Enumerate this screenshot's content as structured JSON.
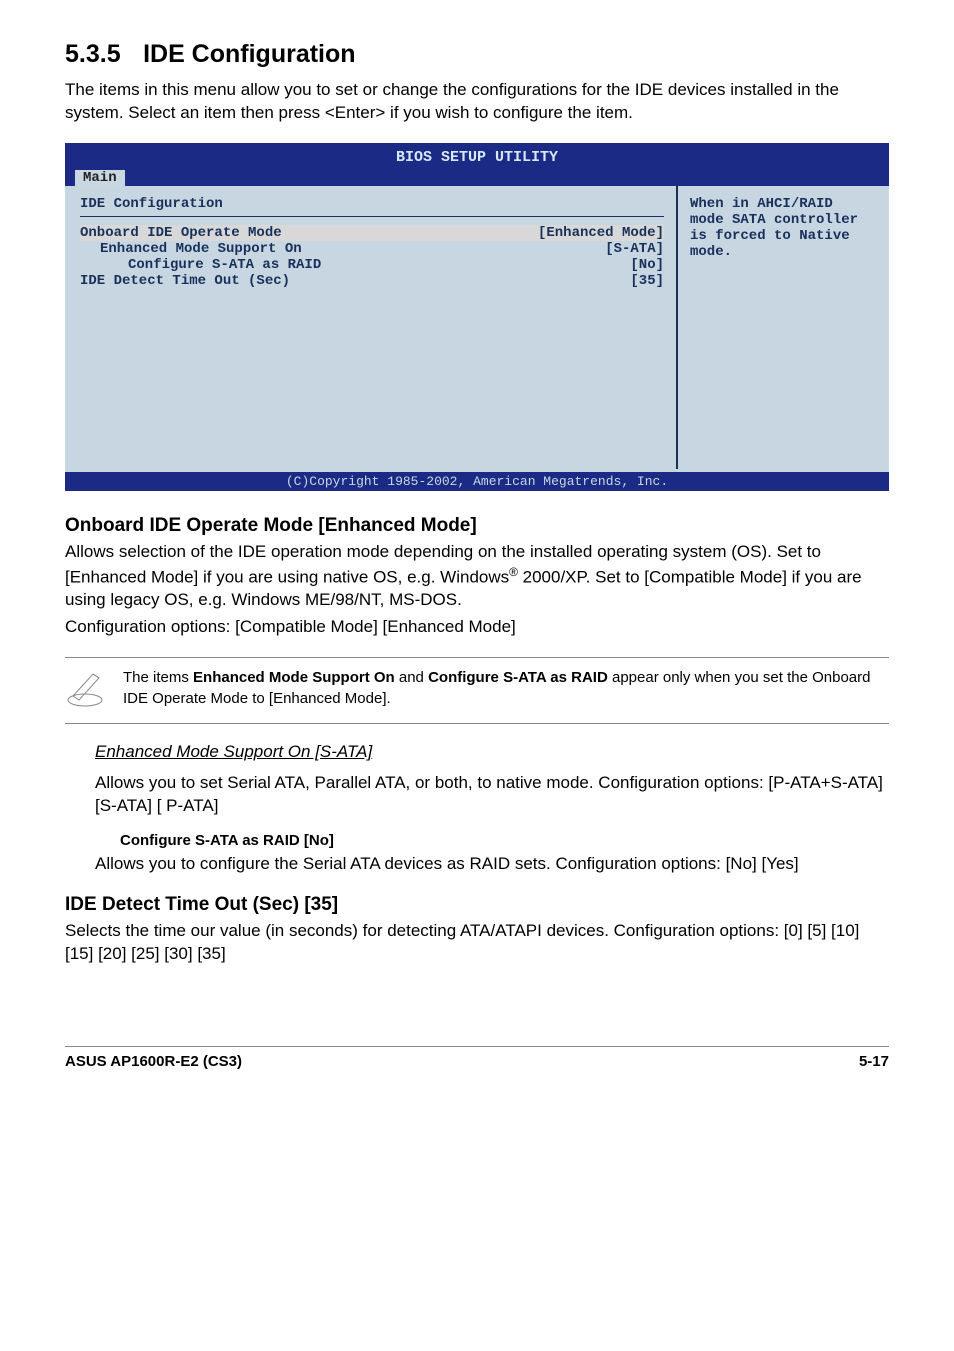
{
  "section": {
    "num": "5.3.5",
    "title": "IDE Configuration"
  },
  "intro": "The items in this menu allow you to set or change the configurations for the IDE devices installed in the system. Select an item then press <Enter> if you wish to configure the item.",
  "bios": {
    "title": "BIOS SETUP UTILITY",
    "tab": "Main",
    "heading": "IDE Configuration",
    "rows": [
      {
        "label": "Onboard IDE Operate Mode",
        "value": "[Enhanced Mode]",
        "indent": 0,
        "highlight": true
      },
      {
        "label": "Enhanced Mode Support On",
        "value": "[S-ATA]",
        "indent": 1
      },
      {
        "label": "Configure S-ATA as RAID",
        "value": "[No]",
        "indent": 2
      },
      {
        "label": "IDE Detect Time Out (Sec)",
        "value": "[35]",
        "indent": 0
      }
    ],
    "help": "When in AHCI/RAID mode SATA controller is forced to Native mode.",
    "footer": "(C)Copyright 1985-2002, American Megatrends, Inc."
  },
  "onboard": {
    "heading": "Onboard IDE Operate Mode [Enhanced Mode]",
    "p1a": "Allows selection of the IDE operation mode depending on the installed operating system (OS). Set to [Enhanced Mode] if you are using native OS, e.g. Windows",
    "p1b": " 2000/XP. Set to [Compatible Mode] if you are using legacy OS, e.g. Windows ME/98/NT, MS-DOS.",
    "p2": "Configuration options: [Compatible Mode] [Enhanced Mode]"
  },
  "note": {
    "pre": "The items ",
    "b1": "Enhanced Mode Support On",
    "mid": " and ",
    "b2": "Configure S-ATA as RAID",
    "post": " appear only when you set the Onboard IDE Operate Mode to [Enhanced Mode]."
  },
  "enhanced": {
    "title": "Enhanced Mode Support On [S-ATA]",
    "p1": "Allows you to set Serial ATA, Parallel ATA, or both, to native mode. Configuration options: [P-ATA+S-ATA] [S-ATA] [ P-ATA]"
  },
  "configure": {
    "title": "Configure S-ATA as RAID [No]",
    "p1": "Allows you to configure the Serial ATA devices as RAID sets. Configuration options: [No] [Yes]"
  },
  "detect": {
    "heading": "IDE Detect Time Out (Sec) [35]",
    "p1": "Selects the time our value (in seconds) for detecting ATA/ATAPI devices. Configuration options: [0] [5] [10] [15] [20] [25] [30] [35]"
  },
  "footer": {
    "left": "ASUS AP1600R-E2 (CS3)",
    "right": "5-17"
  }
}
